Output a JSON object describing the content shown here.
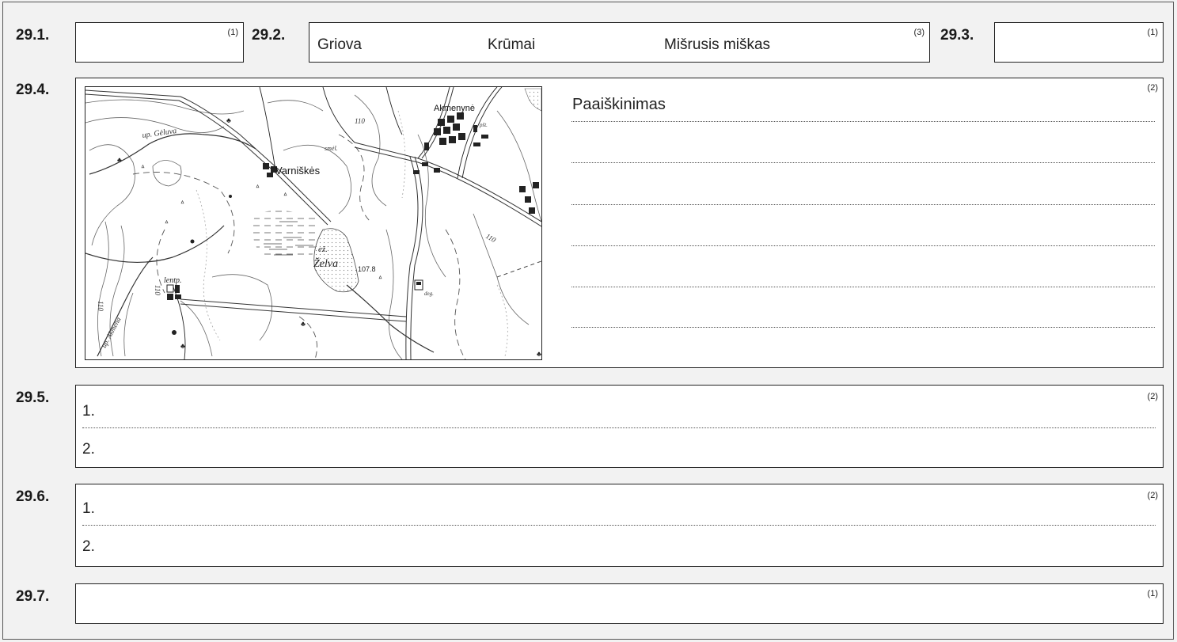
{
  "questions": {
    "q1": {
      "number": "29.1.",
      "points": "(1)"
    },
    "q2": {
      "number": "29.2.",
      "points": "(3)",
      "answers": [
        "Griova",
        "Krūmai",
        "Mišrusis miškas"
      ]
    },
    "q3": {
      "number": "29.3.",
      "points": "(1)"
    },
    "q4": {
      "number": "29.4.",
      "points": "(2)",
      "explanation_label": "Paaiškinimas"
    },
    "q5": {
      "number": "29.5.",
      "points": "(2)",
      "line1": "1.",
      "line2": "2."
    },
    "q6": {
      "number": "29.6.",
      "points": "(2)",
      "line1": "1.",
      "line2": "2."
    },
    "q7": {
      "number": "29.7.",
      "points": "(1)"
    }
  },
  "map": {
    "labels": {
      "village1": "Akmenynė",
      "village2": "Varniškės",
      "river1": "up. Gėluva",
      "river2": "up. Akmena",
      "lake_prefix": "ež.",
      "lake": "Želva",
      "elevation": "107.8",
      "contour1": "110",
      "contour2": "110",
      "contour3": "110",
      "contour4": "110",
      "sawmill": "lentp.",
      "sand": "smėl.",
      "post": "pšt.",
      "gas": "deg."
    }
  }
}
